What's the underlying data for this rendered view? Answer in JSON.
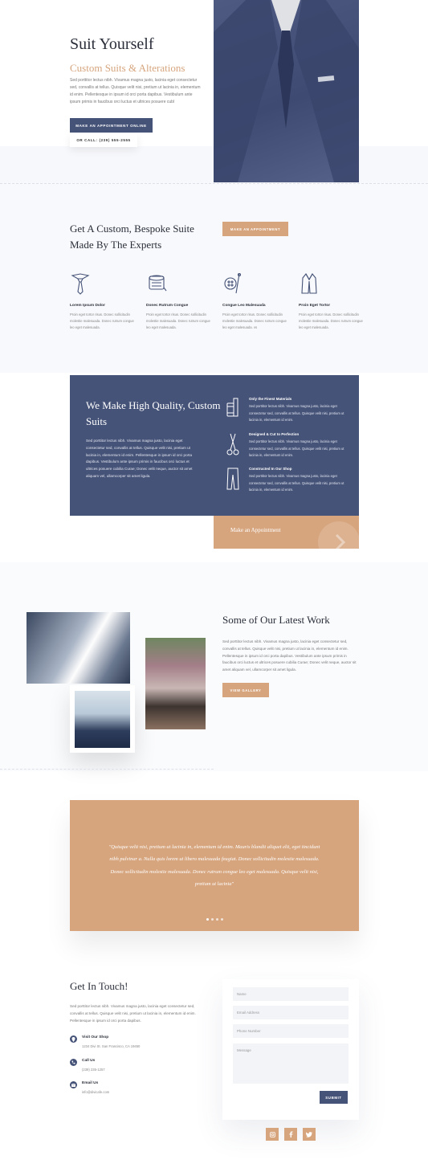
{
  "colors": {
    "navy": "#465378",
    "tan": "#d6a57e",
    "dark": "#2b2f3a"
  },
  "hero": {
    "title": "Suit Yourself",
    "subtitle": "Custom Suits & Alterations",
    "body": "Sed porttitor lectus nibh. Vivamus magna justo, lacinia eget consectetur sed, convallis at tellus. Quisque velit nisi, pretium ut lacinia in, elementum id enim. Pellentesque in ipsum id orci porta dapibus. Vestibulum ante ipsum primis in faucibus orci luctus et ultrices posuere cubl",
    "primary_btn": "MAKE AN APPOINTMENT ONLINE",
    "call_btn": "OR CALL: (239) 555-2555"
  },
  "bespoke": {
    "title": "Get A Custom, Bespoke Suite Made By The Experts",
    "btn": "MAKE AN APPOINTMENT",
    "features": [
      {
        "icon": "tie-icon",
        "title": "Lorem Ipsum Dolor",
        "text": "Proin eget tortor risus. Donec sollicitudin molestie malesuada. Donec rutrum congue leo eget malesuada."
      },
      {
        "icon": "measuring-tape-icon",
        "title": "Donec Rutrum Congue",
        "text": "Proin eget tortor risus. Donec sollicitudin molestie malesuada. Donec rutrum congue leo eget malesuada."
      },
      {
        "icon": "button-needle-icon",
        "title": "Congue Leo Malesuada",
        "text": "Proin eget tortor risus. Donec sollicitudin molestie malesuada. Donec rutrum congue leo eget malesuada. vs"
      },
      {
        "icon": "jacket-icon",
        "title": "Proin Eget Tortor",
        "text": "Proin eget tortor risus. Donec sollicitudin molestie malesuada. Donec rutrum congue leo eget malesuada."
      }
    ]
  },
  "quality": {
    "title": "We Make High Quality, Custom Suits",
    "body": "Sed porttitor lectus nibh. Vivamus magna justo, lacinia eget consectetur sed, convallis at tellus. Quisque velit nisi, pretium ut lacinia in, elementum id enim. Pellentesque in ipsum id orci porta dapibus. Vestibulum ante ipsum primis in faucibus orci luctus et ultrices posuere cubilia Curae; Donec velit neque, auctor sit amet aliquam vel, ullamcorper sit amet ligula.",
    "items": [
      {
        "icon": "thread-spool-icon",
        "title": "Only the Finest Materials",
        "text": "Sed porttitor lectus nibh. Vivamus magna justo, lacinia eget consectetur sed, convallis at tellus. Quisque velit nisi, pretium ut lacinia in, elementum id enim."
      },
      {
        "icon": "scissors-icon",
        "title": "Designed & Cut to Perfection",
        "text": "Sed porttitor lectus nibh. Vivamus magna justo, lacinia eget consectetur sed, convallis at tellus. Quisque velit nisi, pretium ut lacinia in, elementum id enim."
      },
      {
        "icon": "trousers-icon",
        "title": "Constructed In Our Shop",
        "text": "Sed porttitor lectus nibh. Vivamus magna justo, lacinia eget consectetur sed, convallis at tellus. Quisque velit nisi, pretium ut lacinia in, elementum id enim."
      }
    ],
    "appointment": "Make an Appointment"
  },
  "work": {
    "title": "Some of Our Latest Work",
    "body": "Sed porttitor lectus nibh. Vivamus magna justo, lacinia eget consectetur sed, convallis at tellus. Quisque velit nisi, pretium ut lacinia in, elementum id enim. Pellentesque in ipsum id orci porta dapibus. Vestibulum ante ipsum primis in faucibus orci luctus et ultrices posuere cubilia Curae; Donec velit neque, auctor sit amet aliquam vel, ullamcorper sit amet ligula.",
    "btn": "VIEW GALLERY"
  },
  "testimonial": {
    "quote": "\"Quisque velit nisi, pretium ut lacinia in, elementum id enim. Mauris blandit aliquet elit, eget tincidunt nibh pulvinar a. Nulla quis lorem ut libero malesuada feugiat. Donec sollicitudin molestie malesuada. Donec sollicitudin molestie malesuada. Donec rutrum congue leo eget malesuada. Quisque velit nisi, pretium ut lacinia\""
  },
  "contact": {
    "title": "Get In Touch!",
    "body": "Sed porttitor lectus nibh. Vivamus magna justo, lacinia eget consectetur sed, convallis at tellus. Quisque velit nisi, pretium ut lacinia in, elementum id enim. Pellentesque in ipsum id orci porta dapibus.",
    "shop_title": "Visit Our Shop",
    "shop_text": "1234 Divi St. San Francisco, CA 19450",
    "call_title": "Call Us",
    "call_text": "(239) 235-1257",
    "email_title": "Email Us",
    "email_text": "info@divicafe.com"
  },
  "form": {
    "name": "Name",
    "email": "Email Address",
    "phone": "Phone Number",
    "message": "Message",
    "submit": "SUBMIT"
  },
  "social": [
    "instagram-icon",
    "facebook-icon",
    "twitter-icon"
  ]
}
